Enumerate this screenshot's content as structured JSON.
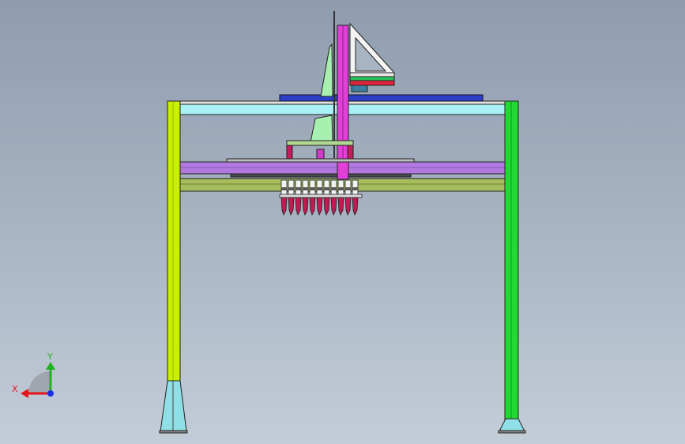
{
  "viewport": {
    "background_top": "#8e9cae",
    "background_bottom": "#c3cdd8"
  },
  "triad": {
    "x_label": "X",
    "y_label": "Y",
    "x_color": "#e8141c",
    "y_color": "#1fb31f",
    "z_color": "#1c2ee8"
  },
  "colors": {
    "left_column": "#c8f000",
    "right_column": "#22d833",
    "top_beam": "#a9f0f7",
    "purple_beam": "#b27ae0",
    "olive_beam": "#a7bc5c",
    "mast": "#e23fd8",
    "top_plate": "#2d3fc8",
    "wedge": "#a8f0b0",
    "frame_bracket": "#c41d5c",
    "gripper": "#c21a52",
    "base": "#8fe0e6"
  }
}
